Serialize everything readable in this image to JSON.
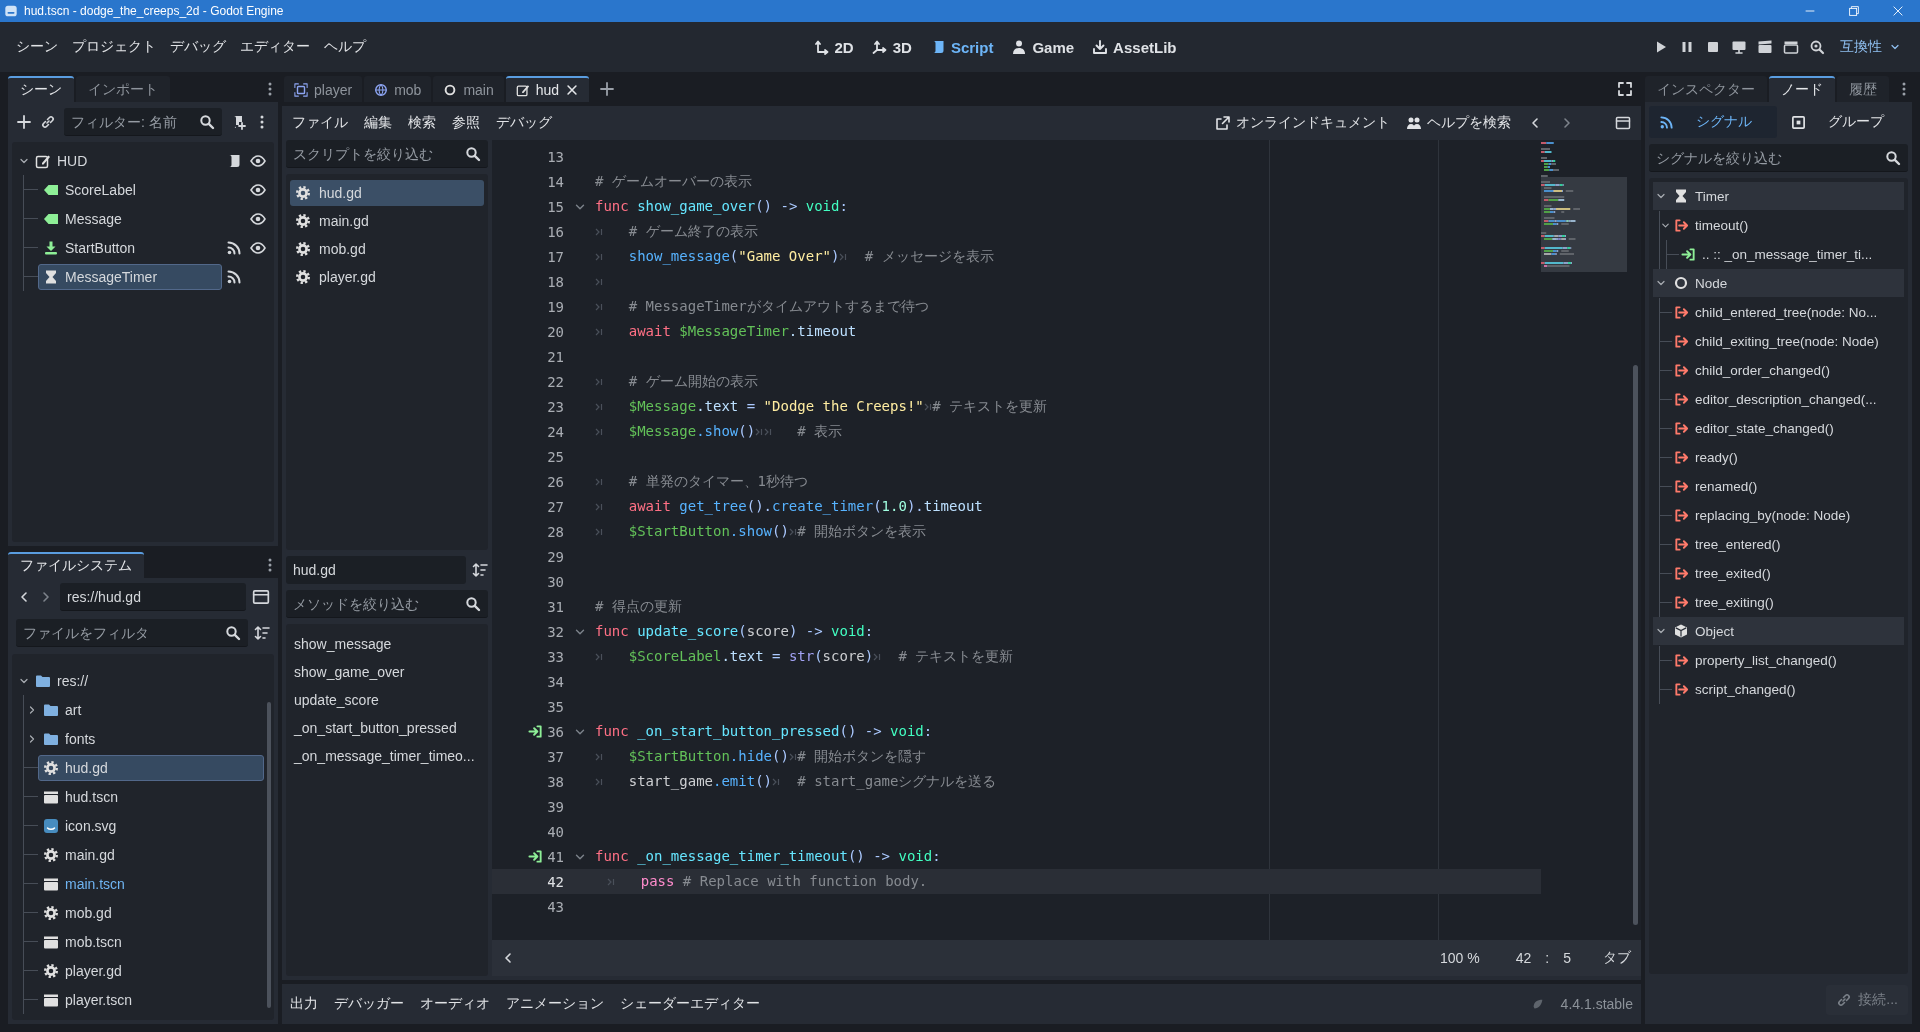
{
  "window": {
    "title": "hud.tscn - dodge_the_creeps_2d - Godot Engine"
  },
  "menu": [
    "シーン",
    "プロジェクト",
    "デバッグ",
    "エディター",
    "ヘルプ"
  ],
  "workspaces": [
    {
      "label": "2D",
      "selected": false
    },
    {
      "label": "3D",
      "selected": false
    },
    {
      "label": "Script",
      "selected": true
    },
    {
      "label": "Game",
      "selected": false
    },
    {
      "label": "AssetLib",
      "selected": false
    }
  ],
  "renderer": "互換性",
  "scene_dock": {
    "tabs": [
      {
        "label": "シーン",
        "selected": true
      },
      {
        "label": "インポート",
        "selected": false
      }
    ],
    "filter": {
      "placeholder": "フィルター: 名前"
    },
    "tree": [
      {
        "name": "HUD",
        "kind": "control",
        "script": true,
        "visible": true,
        "expanded": true,
        "selected": false,
        "children": [
          {
            "name": "ScoreLabel",
            "kind": "label",
            "visible": true,
            "selected": false
          },
          {
            "name": "Message",
            "kind": "label",
            "visible": true,
            "selected": false
          },
          {
            "name": "StartButton",
            "kind": "button",
            "signals": true,
            "visible": true,
            "selected": false
          },
          {
            "name": "MessageTimer",
            "kind": "timer",
            "signals": true,
            "selected": true
          }
        ]
      }
    ]
  },
  "filesystem": {
    "tab": "ファイルシステム",
    "path": "res://hud.gd",
    "filter": {
      "placeholder": "ファイルをフィルタ"
    },
    "tree": [
      {
        "name": "res://",
        "kind": "folder",
        "expanded": true,
        "selected": false,
        "children": [
          {
            "name": "art",
            "kind": "folder",
            "expanded": false,
            "selected": false
          },
          {
            "name": "fonts",
            "kind": "folder",
            "expanded": false,
            "selected": false
          },
          {
            "name": "hud.gd",
            "kind": "script",
            "selected": true
          },
          {
            "name": "hud.tscn",
            "kind": "scene",
            "selected": false
          },
          {
            "name": "icon.svg",
            "kind": "image",
            "selected": false
          },
          {
            "name": "main.gd",
            "kind": "script",
            "selected": false
          },
          {
            "name": "main.tscn",
            "kind": "scene",
            "selected": false,
            "main_scene": true
          },
          {
            "name": "mob.gd",
            "kind": "script",
            "selected": false
          },
          {
            "name": "mob.tscn",
            "kind": "scene",
            "selected": false
          },
          {
            "name": "player.gd",
            "kind": "script",
            "selected": false
          },
          {
            "name": "player.tscn",
            "kind": "scene",
            "selected": false
          }
        ]
      }
    ]
  },
  "script_tabs": [
    {
      "label": "player",
      "kind": "node2d",
      "selected": false
    },
    {
      "label": "mob",
      "kind": "rigidbody",
      "selected": false
    },
    {
      "label": "main",
      "kind": "node",
      "selected": false
    },
    {
      "label": "hud",
      "kind": "control",
      "selected": true
    }
  ],
  "script_menu": [
    "ファイル",
    "編集",
    "検索",
    "参照",
    "デバッグ"
  ],
  "help": [
    "オンラインドキュメント",
    "ヘルプを検索"
  ],
  "scripts": {
    "filter": {
      "placeholder": "スクリプトを絞り込む"
    },
    "items": [
      {
        "label": "hud.gd",
        "selected": true
      },
      {
        "label": "main.gd",
        "selected": false
      },
      {
        "label": "mob.gd",
        "selected": false
      },
      {
        "label": "player.gd",
        "selected": false
      }
    ],
    "current": "hud.gd",
    "methods_filter": {
      "placeholder": "メソッドを絞り込む"
    },
    "methods": [
      "show_message",
      "show_game_over",
      "update_score",
      "_on_start_button_pressed",
      "_on_message_timer_timeo..."
    ]
  },
  "code": {
    "lines": [
      {
        "number": "13"
      },
      {
        "number": "14",
        "tokens": [
          {
            "kind": "cmt",
            "text": "# ゲームオーバーの表示"
          }
        ]
      },
      {
        "number": "15",
        "fold": true,
        "tokens": [
          {
            "kind": "kw",
            "text": "func "
          },
          {
            "kind": "fn",
            "text": "show_game_over"
          },
          {
            "kind": "sym",
            "text": "() -> "
          },
          {
            "kind": "type",
            "text": "void"
          },
          {
            "kind": "sym",
            "text": ":"
          }
        ]
      },
      {
        "number": "16",
        "tokens": [
          {
            "kind": "tab"
          },
          {
            "kind": "cmt",
            "text": "# ゲーム終了の表示"
          }
        ]
      },
      {
        "number": "17",
        "tokens": [
          {
            "kind": "tab"
          },
          {
            "kind": "call",
            "text": "show_message"
          },
          {
            "kind": "sym",
            "text": "("
          },
          {
            "kind": "str",
            "text": "\"Game Over\""
          },
          {
            "kind": "sym",
            "text": ")"
          },
          {
            "kind": "tab"
          },
          {
            "kind": "cmt",
            "text": "# メッセージを表示"
          }
        ]
      },
      {
        "number": "18",
        "tokens": [
          {
            "kind": "tab"
          }
        ]
      },
      {
        "number": "19",
        "tokens": [
          {
            "kind": "tab"
          },
          {
            "kind": "cmt",
            "text": "# MessageTimerがタイムアウトするまで待つ"
          }
        ]
      },
      {
        "number": "20",
        "tokens": [
          {
            "kind": "tab"
          },
          {
            "kind": "kw",
            "text": "await "
          },
          {
            "kind": "node",
            "text": "$MessageTimer"
          },
          {
            "kind": "member",
            "text": ".timeout"
          }
        ]
      },
      {
        "number": "21"
      },
      {
        "number": "22",
        "tokens": [
          {
            "kind": "tab"
          },
          {
            "kind": "cmt",
            "text": "# ゲーム開始の表示"
          }
        ]
      },
      {
        "number": "23",
        "tokens": [
          {
            "kind": "tab"
          },
          {
            "kind": "node",
            "text": "$Message"
          },
          {
            "kind": "member",
            "text": ".text"
          },
          {
            "kind": "sym",
            "text": " = "
          },
          {
            "kind": "str",
            "text": "\"Dodge the Creeps!\""
          },
          {
            "kind": "tab"
          },
          {
            "kind": "cmt",
            "text": "# テキストを更新"
          }
        ]
      },
      {
        "number": "24",
        "tokens": [
          {
            "kind": "tab"
          },
          {
            "kind": "node",
            "text": "$Message"
          },
          {
            "kind": "call",
            "text": ".show"
          },
          {
            "kind": "sym",
            "text": "()"
          },
          {
            "kind": "tab"
          },
          {
            "kind": "tab"
          },
          {
            "kind": "cmt",
            "text": "# 表示"
          }
        ]
      },
      {
        "number": "25"
      },
      {
        "number": "26",
        "tokens": [
          {
            "kind": "tab"
          },
          {
            "kind": "cmt",
            "text": "# 単発のタイマー、1秒待つ"
          }
        ]
      },
      {
        "number": "27",
        "tokens": [
          {
            "kind": "tab"
          },
          {
            "kind": "kw",
            "text": "await "
          },
          {
            "kind": "call",
            "text": "get_tree"
          },
          {
            "kind": "sym",
            "text": "()."
          },
          {
            "kind": "call",
            "text": "create_timer"
          },
          {
            "kind": "sym",
            "text": "("
          },
          {
            "kind": "num",
            "text": "1.0"
          },
          {
            "kind": "sym",
            "text": ")."
          },
          {
            "kind": "member",
            "text": "timeout"
          }
        ]
      },
      {
        "number": "28",
        "tokens": [
          {
            "kind": "tab"
          },
          {
            "kind": "node",
            "text": "$StartButton"
          },
          {
            "kind": "call",
            "text": ".show"
          },
          {
            "kind": "sym",
            "text": "()"
          },
          {
            "kind": "tab"
          },
          {
            "kind": "cmt",
            "text": "# 開始ボタンを表示"
          }
        ]
      },
      {
        "number": "29"
      },
      {
        "number": "30"
      },
      {
        "number": "31",
        "tokens": [
          {
            "kind": "cmt",
            "text": "# 得点の更新"
          }
        ]
      },
      {
        "number": "32",
        "fold": true,
        "tokens": [
          {
            "kind": "kw",
            "text": "func "
          },
          {
            "kind": "fn",
            "text": "update_score"
          },
          {
            "kind": "sym",
            "text": "("
          },
          {
            "kind": "plain",
            "text": "score"
          },
          {
            "kind": "sym",
            "text": ") -> "
          },
          {
            "kind": "type",
            "text": "void"
          },
          {
            "kind": "sym",
            "text": ":"
          }
        ]
      },
      {
        "number": "33",
        "tokens": [
          {
            "kind": "tab"
          },
          {
            "kind": "node",
            "text": "$ScoreLabel"
          },
          {
            "kind": "member",
            "text": ".text"
          },
          {
            "kind": "sym",
            "text": " = "
          },
          {
            "kind": "builtin",
            "text": "str"
          },
          {
            "kind": "sym",
            "text": "("
          },
          {
            "kind": "plain",
            "text": "score"
          },
          {
            "kind": "sym",
            "text": ")"
          },
          {
            "kind": "tab"
          },
          {
            "kind": "cmt",
            "text": "# テキストを更新"
          }
        ]
      },
      {
        "number": "34"
      },
      {
        "number": "35"
      },
      {
        "number": "36",
        "fold": true,
        "connected": true,
        "tokens": [
          {
            "kind": "kw",
            "text": "func "
          },
          {
            "kind": "fn",
            "text": "_on_start_button_pressed"
          },
          {
            "kind": "sym",
            "text": "() -> "
          },
          {
            "kind": "type",
            "text": "void"
          },
          {
            "kind": "sym",
            "text": ":"
          }
        ]
      },
      {
        "number": "37",
        "tokens": [
          {
            "kind": "tab"
          },
          {
            "kind": "node",
            "text": "$StartButton"
          },
          {
            "kind": "call",
            "text": ".hide"
          },
          {
            "kind": "sym",
            "text": "()"
          },
          {
            "kind": "tab"
          },
          {
            "kind": "cmt",
            "text": "# 開始ボタンを隠す"
          }
        ]
      },
      {
        "number": "38",
        "tokens": [
          {
            "kind": "tab"
          },
          {
            "kind": "plain",
            "text": "start_game"
          },
          {
            "kind": "call",
            "text": ".emit"
          },
          {
            "kind": "sym",
            "text": "()"
          },
          {
            "kind": "tab"
          },
          {
            "kind": "cmt",
            "text": "# start_gameシグナルを送る"
          }
        ]
      },
      {
        "number": "39"
      },
      {
        "number": "40"
      },
      {
        "number": "41",
        "fold": true,
        "connected": true,
        "tokens": [
          {
            "kind": "kw",
            "text": "func "
          },
          {
            "kind": "fn",
            "text": "_on_message_timer_timeout"
          },
          {
            "kind": "sym",
            "text": "() -> "
          },
          {
            "kind": "type",
            "text": "void"
          },
          {
            "kind": "sym",
            "text": ":"
          }
        ]
      },
      {
        "number": "42",
        "current": true,
        "tokens": [
          {
            "kind": "tab"
          },
          {
            "kind": "ctrl",
            "text": "pass"
          },
          {
            "kind": "cmt",
            "text": " # Replace with function body."
          }
        ]
      },
      {
        "number": "43"
      }
    ]
  },
  "status": {
    "zoom": "100 %",
    "line": "42",
    "separator": ":",
    "column": "5",
    "indentation": "タブ"
  },
  "bottom_panel": {
    "tabs": [
      "出力",
      "デバッガー",
      "オーディオ",
      "アニメーション",
      "シェーダーエディター"
    ],
    "version": "4.4.1.stable"
  },
  "node_dock": {
    "tabs": [
      {
        "label": "インスペクター",
        "selected": false
      },
      {
        "label": "ノード",
        "selected": true
      },
      {
        "label": "履歴",
        "selected": false
      }
    ],
    "modes": [
      {
        "label": "シグナル",
        "selected": true
      },
      {
        "label": "グループ",
        "selected": false
      }
    ],
    "filter": {
      "placeholder": "シグナルを絞り込む"
    },
    "sections": [
      {
        "name": "Timer",
        "kind": "timer",
        "expanded": true,
        "signals": [
          {
            "name": "timeout()",
            "expanded": true,
            "connections": [
              ".. :: _on_message_timer_ti..."
            ]
          }
        ]
      },
      {
        "name": "Node",
        "kind": "node",
        "expanded": true,
        "signals": [
          {
            "name": "child_entered_tree(node: No..."
          },
          {
            "name": "child_exiting_tree(node: Node)"
          },
          {
            "name": "child_order_changed()"
          },
          {
            "name": "editor_description_changed(..."
          },
          {
            "name": "editor_state_changed()"
          },
          {
            "name": "ready()"
          },
          {
            "name": "renamed()"
          },
          {
            "name": "replacing_by(node: Node)"
          },
          {
            "name": "tree_entered()"
          },
          {
            "name": "tree_exited()"
          },
          {
            "name": "tree_exiting()"
          }
        ]
      },
      {
        "name": "Object",
        "kind": "object",
        "expanded": true,
        "signals": [
          {
            "name": "property_list_changed()"
          },
          {
            "name": "script_changed()"
          }
        ]
      }
    ],
    "connect_button": {
      "label": "接続...",
      "disabled": true
    }
  }
}
